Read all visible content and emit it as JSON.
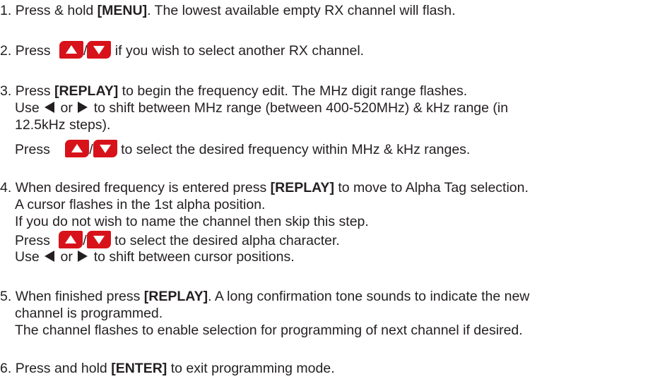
{
  "steps": [
    {
      "num": "1. ",
      "t1": "Press & hold ",
      "b1": "[MENU]",
      "t2": ". The lowest available empty RX channel will flash."
    },
    {
      "num": "2. ",
      "t1": "Press ",
      "slash": "/",
      "t2": " if you wish to select another RX channel."
    },
    {
      "num": "3. ",
      "t1": "Press ",
      "b1": "[REPLAY]",
      "t2": " to begin the frequency edit. The MHz digit range flashes.",
      "l2a": "Use ",
      "l2or": " or ",
      "l2b": " to shift between MHz range (between 400-520MHz) & kHz range (in",
      "l3": "12.5kHz steps).",
      "l4a": "Press ",
      "slash": "/",
      "l4b": " to select the desired frequency within MHz & kHz ranges."
    },
    {
      "num": "4. ",
      "t1": "When desired frequency is entered press ",
      "b1": "[REPLAY]",
      "t2": " to move to Alpha Tag selection.",
      "l2": "A cursor flashes in the 1st alpha position.",
      "l3": "If you do not wish to name the channel then skip this step.",
      "l4a": "Press ",
      "slash": "/",
      "l4b": " to select the desired alpha character.",
      "l5a": "Use ",
      "l5or": " or ",
      "l5b": " to shift between cursor positions."
    },
    {
      "num": "5. ",
      "t1": "When finished press ",
      "b1": "[REPLAY]",
      "t2": ". A long confirmation tone sounds to indicate the new",
      "l2": "channel is programmed.",
      "l3": "The channel flashes to enable selection for programming of next channel if desired."
    },
    {
      "num": "6. ",
      "t1": "Press and hold ",
      "b1": "[ENTER]",
      "t2": " to exit programming mode."
    }
  ]
}
